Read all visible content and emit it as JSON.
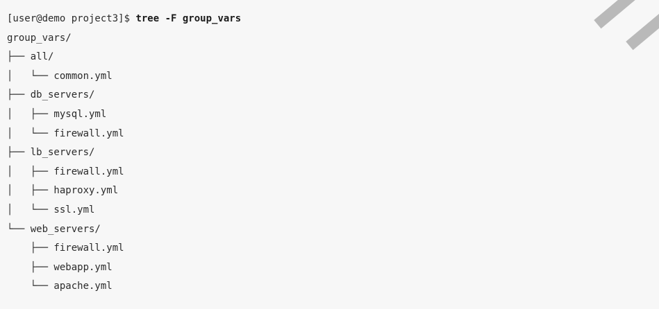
{
  "terminal": {
    "prompt": "[user@demo project3]$ ",
    "command": "tree -F group_vars",
    "output_lines": [
      "group_vars/",
      "├── all/",
      "│   └── common.yml",
      "├── db_servers/",
      "│   ├── mysql.yml",
      "│   └── firewall.yml",
      "├── lb_servers/",
      "│   ├── firewall.yml",
      "│   ├── haproxy.yml",
      "│   └── ssl.yml",
      "└── web_servers/",
      "    ├── firewall.yml",
      "    ├── webapp.yml",
      "    └── apache.yml"
    ]
  },
  "colors": {
    "background": "#f7f7f7",
    "text": "#2b2b2b",
    "decoration": "#b9b9b9"
  }
}
